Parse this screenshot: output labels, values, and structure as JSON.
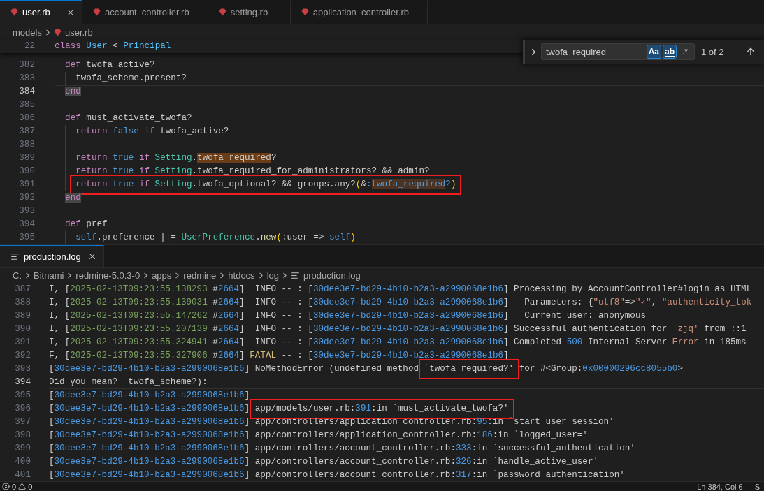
{
  "tabs": [
    {
      "label": "user.rb",
      "kind": "ruby",
      "selected": true
    },
    {
      "label": "account_controller.rb",
      "kind": "ruby",
      "selected": false
    },
    {
      "label": "setting.rb",
      "kind": "ruby",
      "selected": false
    },
    {
      "label": "application_controller.rb",
      "kind": "ruby",
      "selected": false
    }
  ],
  "breadcrumbs": [
    {
      "label": "models",
      "kind": "folder"
    },
    {
      "label": "user.rb",
      "kind": "ruby"
    }
  ],
  "sticky_line": {
    "number": "22",
    "parts": [
      {
        "annotated": false,
        "tokens": [
          {
            "text": "class ",
            "kind": "keyword"
          },
          {
            "text": "User",
            "kind": "constant"
          },
          {
            "text": " < ",
            "kind": "plain"
          },
          {
            "text": "Principal",
            "kind": "constant"
          }
        ]
      }
    ]
  },
  "find": {
    "query": "twofa_required",
    "toggles": [
      {
        "label": "Aa",
        "kind": "match-case",
        "pressed": true
      },
      {
        "label": "ab",
        "kind": "whole-word",
        "pressed": true
      },
      {
        "label": ".*",
        "kind": "regex",
        "pressed": false
      }
    ],
    "result": "1 of 2"
  },
  "editor": {
    "lines": [
      {
        "number": "382",
        "current": false,
        "parts": [
          {
            "annotated": false,
            "tokens": [
              {
                "text": "def",
                "kind": "keyword"
              },
              {
                "text": " twofa_active?",
                "kind": "plain"
              }
            ]
          }
        ],
        "children": [
          {
            "number": "383",
            "current": false,
            "parts": [
              {
                "annotated": false,
                "tokens": [
                  {
                    "text": "twofa_scheme.present?",
                    "kind": "plain"
                  }
                ]
              }
            ]
          }
        ]
      },
      {
        "number": "384",
        "current": true,
        "parts": [
          {
            "annotated": false,
            "tokens": [
              {
                "text": "end",
                "kind": "keyword",
                "word_highlight": true
              }
            ]
          }
        ]
      },
      {
        "number": "385",
        "current": false
      },
      {
        "number": "386",
        "current": false,
        "parts": [
          {
            "annotated": false,
            "tokens": [
              {
                "text": "def",
                "kind": "keyword"
              },
              {
                "text": " must_activate_twofa?",
                "kind": "plain"
              }
            ]
          }
        ],
        "children": [
          {
            "number": "387",
            "current": false,
            "parts": [
              {
                "annotated": false,
                "tokens": [
                  {
                    "text": "return ",
                    "kind": "keyword"
                  },
                  {
                    "text": "false ",
                    "kind": "literal"
                  },
                  {
                    "text": "if",
                    "kind": "keyword"
                  },
                  {
                    "text": " twofa_active?",
                    "kind": "plain"
                  }
                ]
              }
            ]
          },
          {
            "number": "388",
            "current": false
          },
          {
            "number": "389",
            "current": false,
            "parts": [
              {
                "annotated": false,
                "tokens": [
                  {
                    "text": "return ",
                    "kind": "keyword"
                  },
                  {
                    "text": "true ",
                    "kind": "literal"
                  },
                  {
                    "text": "if ",
                    "kind": "keyword"
                  },
                  {
                    "text": "Setting",
                    "kind": "class"
                  },
                  {
                    "text": ".",
                    "kind": "plain"
                  },
                  {
                    "text": "twofa_required",
                    "kind": "plain",
                    "find_match": true,
                    "selected": true
                  },
                  {
                    "text": "?",
                    "kind": "plain"
                  }
                ]
              }
            ]
          },
          {
            "number": "390",
            "current": false,
            "parts": [
              {
                "annotated": false,
                "tokens": [
                  {
                    "text": "return ",
                    "kind": "keyword"
                  },
                  {
                    "text": "true ",
                    "kind": "literal"
                  },
                  {
                    "text": "if ",
                    "kind": "keyword"
                  },
                  {
                    "text": "Setting",
                    "kind": "class"
                  },
                  {
                    "text": ".twofa_required_for_administrators? && admin?",
                    "kind": "plain"
                  }
                ]
              }
            ]
          },
          {
            "number": "391",
            "current": false,
            "parts": [
              {
                "annotated": true,
                "tokens": [
                  {
                    "text": "return ",
                    "kind": "keyword"
                  },
                  {
                    "text": "true ",
                    "kind": "literal"
                  },
                  {
                    "text": "if ",
                    "kind": "keyword"
                  },
                  {
                    "text": "Setting",
                    "kind": "class"
                  },
                  {
                    "text": ".twofa_optional? && groups.any?",
                    "kind": "plain"
                  },
                  {
                    "text": "(",
                    "kind": "bracket"
                  },
                  {
                    "text": "&",
                    "kind": "plain"
                  },
                  {
                    "text": ":",
                    "kind": "symbol"
                  },
                  {
                    "text": "twofa_required",
                    "kind": "symbol",
                    "find_match": true,
                    "selected": false
                  },
                  {
                    "text": "?",
                    "kind": "symbol"
                  },
                  {
                    "text": ")",
                    "kind": "bracket"
                  }
                ]
              }
            ]
          }
        ]
      },
      {
        "number": "392",
        "current": false,
        "parts": [
          {
            "annotated": false,
            "tokens": [
              {
                "text": "end",
                "kind": "keyword",
                "word_highlight": true
              }
            ]
          }
        ]
      },
      {
        "number": "393",
        "current": false
      },
      {
        "number": "394",
        "current": false,
        "parts": [
          {
            "annotated": false,
            "tokens": [
              {
                "text": "def",
                "kind": "keyword"
              },
              {
                "text": " pref",
                "kind": "plain"
              }
            ]
          }
        ],
        "children": [
          {
            "number": "395",
            "current": false,
            "parts": [
              {
                "annotated": false,
                "tokens": [
                  {
                    "text": "self",
                    "kind": "literal"
                  },
                  {
                    "text": ".preference ||= ",
                    "kind": "plain"
                  },
                  {
                    "text": "UserPreference",
                    "kind": "class"
                  },
                  {
                    "text": ".",
                    "kind": "plain"
                  },
                  {
                    "text": "new",
                    "kind": "function"
                  },
                  {
                    "text": "(",
                    "kind": "bracket"
                  },
                  {
                    "text": ":user => ",
                    "kind": "plain"
                  },
                  {
                    "text": "self",
                    "kind": "literal"
                  },
                  {
                    "text": ")",
                    "kind": "bracket"
                  }
                ]
              }
            ]
          }
        ]
      }
    ]
  },
  "panel": {
    "tabs": [
      {
        "label": "production.log",
        "kind": "log",
        "selected": true
      }
    ],
    "breadcrumbs": [
      {
        "label": "C:",
        "kind": "folder"
      },
      {
        "label": "Bitnami",
        "kind": "folder"
      },
      {
        "label": "redmine-5.0.3-0",
        "kind": "folder"
      },
      {
        "label": "apps",
        "kind": "folder"
      },
      {
        "label": "redmine",
        "kind": "folder"
      },
      {
        "label": "htdocs",
        "kind": "folder"
      },
      {
        "label": "log",
        "kind": "folder"
      },
      {
        "label": "production.log",
        "kind": "log"
      }
    ],
    "lines": [
      {
        "number": "387",
        "current": false,
        "parts": [
          {
            "annotated": false,
            "tokens": [
              {
                "text": "I, [",
                "kind": "plain"
              },
              {
                "text": "2025-02-13T09:23:55.138293",
                "kind": "date"
              },
              {
                "text": " #",
                "kind": "plain"
              },
              {
                "text": "2664",
                "kind": "number"
              },
              {
                "text": "]  INFO -- : [",
                "kind": "plain"
              },
              {
                "text": "30dee3e7-bd29-4b10-b2a3-a2990068e1b6",
                "kind": "id"
              },
              {
                "text": "] Processing by AccountController#login as HTML",
                "kind": "plain"
              }
            ]
          }
        ]
      },
      {
        "number": "388",
        "current": false,
        "parts": [
          {
            "annotated": false,
            "tokens": [
              {
                "text": "I, [",
                "kind": "plain"
              },
              {
                "text": "2025-02-13T09:23:55.139031",
                "kind": "date"
              },
              {
                "text": " #",
                "kind": "plain"
              },
              {
                "text": "2664",
                "kind": "number"
              },
              {
                "text": "]  INFO -- : [",
                "kind": "plain"
              },
              {
                "text": "30dee3e7-bd29-4b10-b2a3-a2990068e1b6",
                "kind": "id"
              },
              {
                "text": "]   Parameters: {",
                "kind": "plain"
              },
              {
                "text": "\"utf8\"",
                "kind": "string"
              },
              {
                "text": "=>",
                "kind": "plain"
              },
              {
                "text": "\"✓\"",
                "kind": "string"
              },
              {
                "text": ", ",
                "kind": "plain"
              },
              {
                "text": "\"authenticity_tok",
                "kind": "string"
              }
            ]
          }
        ]
      },
      {
        "number": "389",
        "current": false,
        "parts": [
          {
            "annotated": false,
            "tokens": [
              {
                "text": "I, [",
                "kind": "plain"
              },
              {
                "text": "2025-02-13T09:23:55.147262",
                "kind": "date"
              },
              {
                "text": " #",
                "kind": "plain"
              },
              {
                "text": "2664",
                "kind": "number"
              },
              {
                "text": "]  INFO -- : [",
                "kind": "plain"
              },
              {
                "text": "30dee3e7-bd29-4b10-b2a3-a2990068e1b6",
                "kind": "id"
              },
              {
                "text": "]   Current user: anonymous",
                "kind": "plain"
              }
            ]
          }
        ]
      },
      {
        "number": "390",
        "current": false,
        "parts": [
          {
            "annotated": false,
            "tokens": [
              {
                "text": "I, [",
                "kind": "plain"
              },
              {
                "text": "2025-02-13T09:23:55.207139",
                "kind": "date"
              },
              {
                "text": " #",
                "kind": "plain"
              },
              {
                "text": "2664",
                "kind": "number"
              },
              {
                "text": "]  INFO -- : [",
                "kind": "plain"
              },
              {
                "text": "30dee3e7-bd29-4b10-b2a3-a2990068e1b6",
                "kind": "id"
              },
              {
                "text": "] Successful authentication for ",
                "kind": "plain"
              },
              {
                "text": "'zjq'",
                "kind": "string"
              },
              {
                "text": " from ::1",
                "kind": "plain"
              }
            ]
          }
        ]
      },
      {
        "number": "391",
        "current": false,
        "parts": [
          {
            "annotated": false,
            "tokens": [
              {
                "text": "I, [",
                "kind": "plain"
              },
              {
                "text": "2025-02-13T09:23:55.324941",
                "kind": "date"
              },
              {
                "text": " #",
                "kind": "plain"
              },
              {
                "text": "2664",
                "kind": "number"
              },
              {
                "text": "]  INFO -- : [",
                "kind": "plain"
              },
              {
                "text": "30dee3e7-bd29-4b10-b2a3-a2990068e1b6",
                "kind": "id"
              },
              {
                "text": "] Completed ",
                "kind": "plain"
              },
              {
                "text": "500",
                "kind": "number"
              },
              {
                "text": " Internal Server ",
                "kind": "plain"
              },
              {
                "text": "Error",
                "kind": "error"
              },
              {
                "text": " in 185ms",
                "kind": "plain"
              }
            ]
          }
        ]
      },
      {
        "number": "392",
        "current": false,
        "parts": [
          {
            "annotated": false,
            "tokens": [
              {
                "text": "F, [",
                "kind": "plain"
              },
              {
                "text": "2025-02-13T09:23:55.327906",
                "kind": "date"
              },
              {
                "text": " #",
                "kind": "plain"
              },
              {
                "text": "2664",
                "kind": "number"
              },
              {
                "text": "] ",
                "kind": "plain"
              },
              {
                "text": "FATAL",
                "kind": "fatal"
              },
              {
                "text": " -- : [",
                "kind": "plain"
              },
              {
                "text": "30dee3e7-bd29-4b10-b2a3-a2990068e1b6",
                "kind": "id"
              },
              {
                "text": "]",
                "kind": "plain"
              }
            ]
          }
        ]
      },
      {
        "number": "393",
        "current": false,
        "parts": [
          {
            "annotated": false,
            "tokens": [
              {
                "text": "[",
                "kind": "plain"
              },
              {
                "text": "30dee3e7-bd29-4b10-b2a3-a2990068e1b6",
                "kind": "id"
              },
              {
                "text": "] NoMethodError (undefined method ",
                "kind": "plain"
              }
            ]
          },
          {
            "annotated": true,
            "tokens": [
              {
                "text": "`twofa_required?'",
                "kind": "plain"
              }
            ]
          },
          {
            "annotated": false,
            "tokens": [
              {
                "text": " for #<Group:",
                "kind": "plain"
              },
              {
                "text": "0x00000296cc8055b0",
                "kind": "number"
              },
              {
                "text": ">",
                "kind": "plain"
              }
            ]
          }
        ]
      },
      {
        "number": "394",
        "current": true,
        "parts": [
          {
            "annotated": false,
            "tokens": [
              {
                "text": "Did you mean?  twofa_scheme?):",
                "kind": "plain"
              }
            ]
          }
        ]
      },
      {
        "number": "395",
        "current": false,
        "parts": [
          {
            "annotated": false,
            "tokens": [
              {
                "text": "[",
                "kind": "plain"
              },
              {
                "text": "30dee3e7-bd29-4b10-b2a3-a2990068e1b6",
                "kind": "id"
              },
              {
                "text": "]",
                "kind": "plain"
              }
            ]
          }
        ]
      },
      {
        "number": "396",
        "current": false,
        "parts": [
          {
            "annotated": false,
            "tokens": [
              {
                "text": "[",
                "kind": "plain"
              },
              {
                "text": "30dee3e7-bd29-4b10-b2a3-a2990068e1b6",
                "kind": "id"
              },
              {
                "text": "] ",
                "kind": "plain"
              }
            ]
          },
          {
            "annotated": true,
            "tokens": [
              {
                "text": "app/models/user.rb:",
                "kind": "plain"
              },
              {
                "text": "391",
                "kind": "number"
              },
              {
                "text": ":in `must_activate_twofa?'",
                "kind": "plain"
              }
            ]
          }
        ]
      },
      {
        "number": "397",
        "current": false,
        "parts": [
          {
            "annotated": false,
            "tokens": [
              {
                "text": "[",
                "kind": "plain"
              },
              {
                "text": "30dee3e7-bd29-4b10-b2a3-a2990068e1b6",
                "kind": "id"
              },
              {
                "text": "] app/controllers/application_controller.rb:",
                "kind": "plain"
              },
              {
                "text": "95",
                "kind": "number"
              },
              {
                "text": ":in `start_user_session'",
                "kind": "plain"
              }
            ]
          }
        ]
      },
      {
        "number": "398",
        "current": false,
        "parts": [
          {
            "annotated": false,
            "tokens": [
              {
                "text": "[",
                "kind": "plain"
              },
              {
                "text": "30dee3e7-bd29-4b10-b2a3-a2990068e1b6",
                "kind": "id"
              },
              {
                "text": "] app/controllers/application_controller.rb:",
                "kind": "plain"
              },
              {
                "text": "186",
                "kind": "number"
              },
              {
                "text": ":in `logged_user='",
                "kind": "plain"
              }
            ]
          }
        ]
      },
      {
        "number": "399",
        "current": false,
        "parts": [
          {
            "annotated": false,
            "tokens": [
              {
                "text": "[",
                "kind": "plain"
              },
              {
                "text": "30dee3e7-bd29-4b10-b2a3-a2990068e1b6",
                "kind": "id"
              },
              {
                "text": "] app/controllers/account_controller.rb:",
                "kind": "plain"
              },
              {
                "text": "333",
                "kind": "number"
              },
              {
                "text": ":in `successful_authentication'",
                "kind": "plain"
              }
            ]
          }
        ]
      },
      {
        "number": "400",
        "current": false,
        "parts": [
          {
            "annotated": false,
            "tokens": [
              {
                "text": "[",
                "kind": "plain"
              },
              {
                "text": "30dee3e7-bd29-4b10-b2a3-a2990068e1b6",
                "kind": "id"
              },
              {
                "text": "] app/controllers/account_controller.rb:",
                "kind": "plain"
              },
              {
                "text": "326",
                "kind": "number"
              },
              {
                "text": ":in `handle_active_user'",
                "kind": "plain"
              }
            ]
          }
        ]
      },
      {
        "number": "401",
        "current": false,
        "parts": [
          {
            "annotated": false,
            "tokens": [
              {
                "text": "[",
                "kind": "plain"
              },
              {
                "text": "30dee3e7-bd29-4b10-b2a3-a2990068e1b6",
                "kind": "id"
              },
              {
                "text": "] app/controllers/account_controller.rb:",
                "kind": "plain"
              },
              {
                "text": "317",
                "kind": "number"
              },
              {
                "text": ":in `password_authentication'",
                "kind": "plain"
              }
            ]
          }
        ]
      }
    ]
  },
  "status_bar": {
    "errors": "0",
    "warnings": "0",
    "right_items": [
      "Ln 384, Col 6",
      "S"
    ]
  }
}
